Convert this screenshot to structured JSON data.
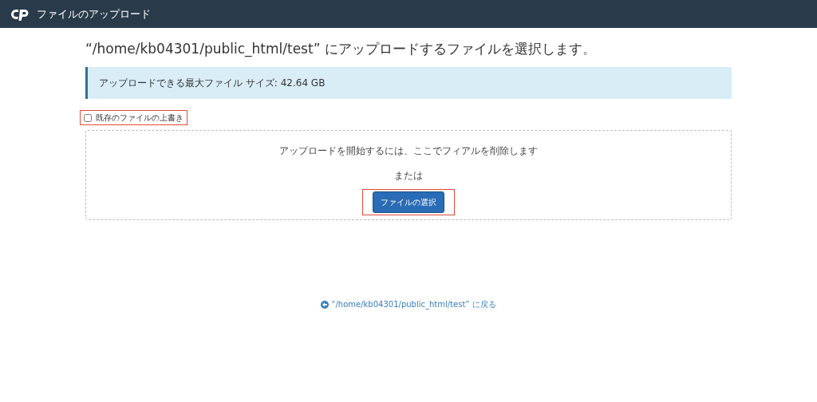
{
  "header": {
    "title": "ファイルのアップロード"
  },
  "heading": "“/home/kb04301/public_html/test” にアップロードするファイルを選択します。",
  "info": "アップロードできる最大ファイル サイズ: 42.64 GB",
  "overwrite": {
    "label": "既存のファイルの上書き",
    "checked": false
  },
  "dropzone": {
    "prompt": "アップロードを開始するには、ここでフィアルを削除します",
    "or": "または",
    "button": "ファイルの選択"
  },
  "back_link": "“/home/kb04301/public_html/test” に戻る"
}
